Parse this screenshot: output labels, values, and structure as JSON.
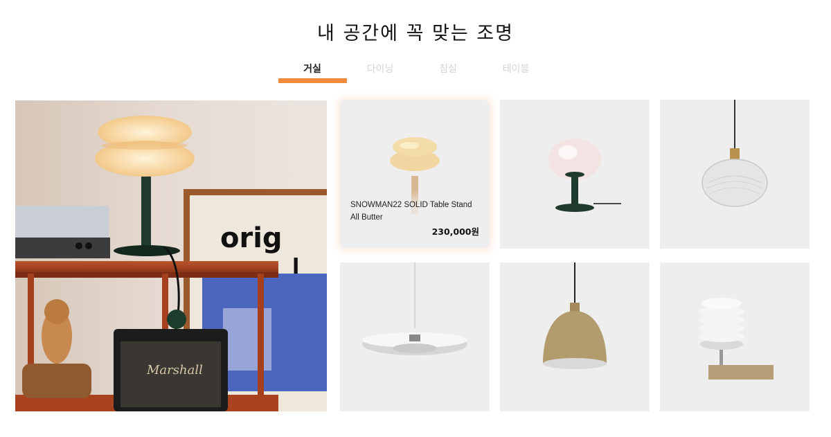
{
  "section_title": "내 공간에 꼭 맞는 조명",
  "tabs": [
    {
      "label": "거실",
      "active": true
    },
    {
      "label": "다이닝",
      "active": false
    },
    {
      "label": "침실",
      "active": false
    },
    {
      "label": "테이블",
      "active": false
    }
  ],
  "accent_color": "#f08a3c",
  "hero": {
    "icon": "living-room-lamp-photo"
  },
  "products": [
    {
      "icon": "snowman-table-lamp",
      "name": "SNOWMAN22 SOLID Table Stand All Butter",
      "price": "230,000원",
      "hovered": true
    },
    {
      "icon": "glass-globe-table-lamp"
    },
    {
      "icon": "ribbed-glass-pendant-lamp"
    },
    {
      "icon": "flat-disc-pendant-lamp"
    },
    {
      "icon": "dome-pendant-lamp"
    },
    {
      "icon": "stacked-rings-table-lamp"
    }
  ]
}
